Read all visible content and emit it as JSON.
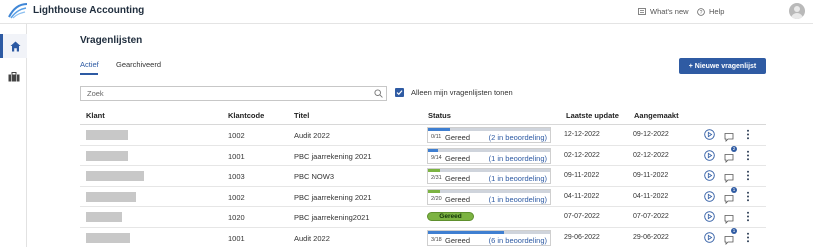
{
  "app": {
    "title": "Lighthouse Accounting"
  },
  "topbar": {
    "whats_new": "What's new",
    "help": "Help"
  },
  "page": {
    "title": "Vragenlijsten"
  },
  "tabs": [
    {
      "label": "Actief",
      "active": true
    },
    {
      "label": "Gearchiveerd",
      "active": false
    }
  ],
  "new_button": {
    "label": "+ Nieuwe vragenlijst"
  },
  "search": {
    "placeholder": "Zoek"
  },
  "filter": {
    "label": "Alleen mijn vragenlijsten tonen",
    "checked": true
  },
  "table": {
    "headers": {
      "klant": "Klant",
      "klantcode": "Klantcode",
      "titel": "Titel",
      "status": "Status",
      "laatste_update": "Laatste update",
      "aangemaakt": "Aangemaakt"
    },
    "rows": [
      {
        "klantcode": "1002",
        "titel": "Audit 2022",
        "status_type": "progress",
        "fraction": "0/11",
        "progress": 0.18,
        "progress_color": "#3f7fd1",
        "status_label": "Gereed",
        "status_link": "(2 in beoordeling)",
        "laatste_update": "12-12-2022",
        "aangemaakt": "09-12-2022",
        "chat_badge": ""
      },
      {
        "klantcode": "1001",
        "titel": "PBC jaarrekening 2021",
        "status_type": "progress",
        "fraction": "9/14",
        "progress": 0.08,
        "progress_color": "#3f7fd1",
        "status_label": "Gereed",
        "status_link": "(1 in beoordeling)",
        "laatste_update": "02-12-2022",
        "aangemaakt": "02-12-2022",
        "chat_badge": "2"
      },
      {
        "klantcode": "1003",
        "titel": "PBC NOW3",
        "status_type": "progress",
        "fraction": "2/31",
        "progress": 0.1,
        "progress_color": "#7cb342",
        "status_label": "Gereed",
        "status_link": "(1 in beoordeling)",
        "laatste_update": "09-11-2022",
        "aangemaakt": "09-11-2022",
        "chat_badge": ""
      },
      {
        "klantcode": "1002",
        "titel": "PBC jaarrekening 2021",
        "status_type": "progress",
        "fraction": "2/20",
        "progress": 0.1,
        "progress_color": "#7cb342",
        "status_label": "Gereed",
        "status_link": "(1 in beoordeling)",
        "laatste_update": "04-11-2022",
        "aangemaakt": "04-11-2022",
        "chat_badge": "1"
      },
      {
        "klantcode": "1020",
        "titel": "PBC jaarrekening2021",
        "status_type": "pill",
        "status_label": "Gereed",
        "laatste_update": "07-07-2022",
        "aangemaakt": "07-07-2022",
        "chat_badge": ""
      },
      {
        "klantcode": "1001",
        "titel": "Audit 2022",
        "status_type": "progress",
        "fraction": "3/18",
        "progress": 0.62,
        "progress_color": "#3f7fd1",
        "status_label": "Gereed",
        "status_link": "(6 in beoordeling)",
        "laatste_update": "29-06-2022",
        "aangemaakt": "29-06-2022",
        "chat_badge": "1"
      }
    ]
  }
}
